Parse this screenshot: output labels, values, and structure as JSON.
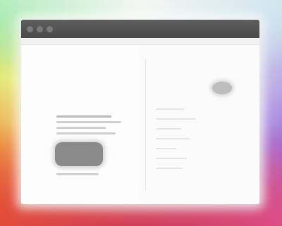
{
  "desktop": {
    "wallpaper_colors": [
      "#8fe0a0",
      "#e6e97a",
      "#f0a04a",
      "#e0503c",
      "#cf3c56",
      "#da4d86",
      "#a073dd",
      "#cfe6ef"
    ]
  },
  "window": {
    "title": "",
    "titlebar_color": "#4f4f4f",
    "background_color": "#fbfbfb",
    "controls": [
      {
        "icon": "close-icon"
      },
      {
        "icon": "minimize-icon"
      },
      {
        "icon": "maximize-icon"
      }
    ]
  },
  "left_pane": {
    "heading": "",
    "body": "",
    "image_icon": "image-icon"
  },
  "right_pane": {
    "avatar_icon": "avatar-icon",
    "text": ""
  }
}
